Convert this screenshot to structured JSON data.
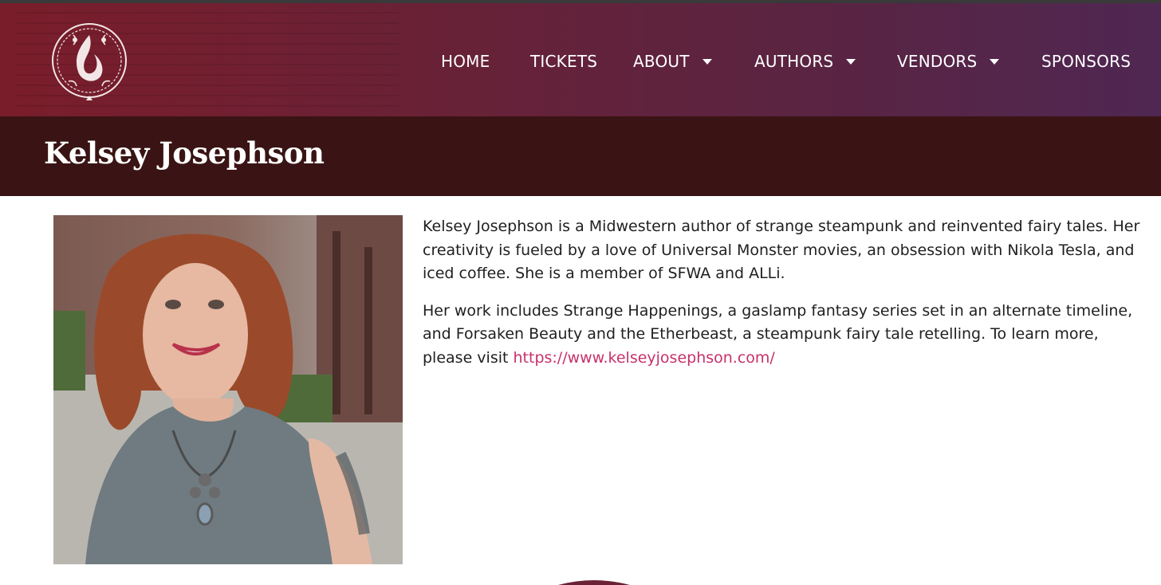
{
  "colors": {
    "nav_gradient_start": "#7a1d2a",
    "nav_gradient_end": "#4f2752",
    "title_bar": "#3a1414",
    "link": "#c7316b",
    "text": "#1f1f1f"
  },
  "logo": {
    "icon": "event-crest-logo"
  },
  "nav": {
    "home": "HOME",
    "tickets": "TICKETS",
    "about": "ABOUT",
    "authors": "AUTHORS",
    "vendors": "VENDORS",
    "sponsors": "SPONSORS"
  },
  "page": {
    "title": "Kelsey Josephson"
  },
  "bio": {
    "p1": "Kelsey Josephson is a Midwestern author of strange steampunk and reinvented fairy tales. Her creativity is fueled by a love of Universal Monster movies, an obsession with Nikola Tesla, and iced coffee. She is a member of SFWA and ALLi.",
    "p2_text": "Her work includes Strange Happenings, a gaslamp fantasy series set in an alternate timeline, and Forsaken Beauty and the Etherbeast, a steampunk fairy tale retelling. To learn more, please visit ",
    "p2_link": "https://www.kelseyjosephson.com/"
  },
  "photo": {
    "icon": "author-portrait-photo"
  }
}
